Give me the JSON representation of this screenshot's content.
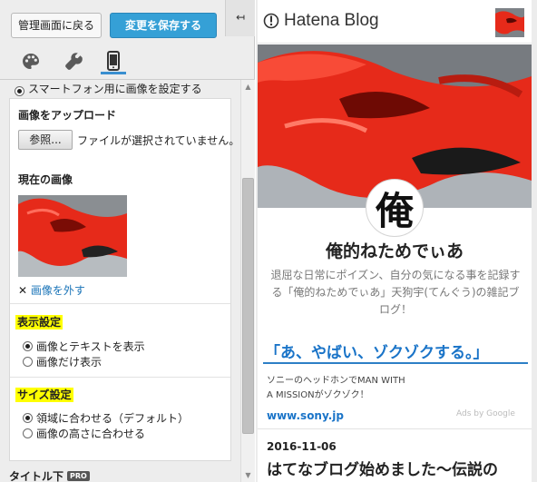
{
  "toolbar": {
    "back_label": "管理画面に戻る",
    "save_label": "変更を保存する",
    "collapse_glyph": "↤"
  },
  "tabs": [
    {
      "icon": "palette-icon",
      "label": "デザイン"
    },
    {
      "icon": "wrench-icon",
      "label": "カスタマイズ"
    },
    {
      "icon": "smartphone-icon",
      "label": "スマホ",
      "active": true
    }
  ],
  "panel": {
    "smartphone_image_option": "スマートフォン用に画像を設定する",
    "upload_heading": "画像をアップロード",
    "browse_label": "参照...",
    "file_status": "ファイルが選択されていません。",
    "current_image_heading": "現在の画像",
    "remove_image_label": "画像を外す",
    "display_heading": "表示設定",
    "display_options": [
      "画像とテキストを表示",
      "画像だけ表示"
    ],
    "display_selected": 0,
    "size_heading": "サイズ設定",
    "size_options": [
      "領域に合わせる（デフォルト）",
      "画像の高さに合わせる"
    ],
    "size_selected": 0,
    "next_section_label": "タイトル下",
    "pro_badge": "PRO"
  },
  "preview": {
    "logo_text": "Hatena Blog",
    "icon_char": "俺",
    "blog_title": "俺的ねためでぃあ",
    "blog_description": "退屈な日常にポイズン、自分の気になる事を記録する「俺的ねためでぃあ」天狗宇(てんぐう)の雑記ブログ！",
    "ad": {
      "headline": "「あ、やばい、ゾクゾクする。」",
      "body_line1": "ソニーのヘッドホンでMAN WITH",
      "body_line2": "A MISSIONがゾクゾク！",
      "domain": "www.sony.jp",
      "ads_by": "Ads by Google"
    },
    "post": {
      "date": "2016-11-06",
      "title": "はてなブログ始めました～伝説の"
    }
  },
  "colors": {
    "accent_blue": "#35a0d6",
    "link_blue": "#1a74c8",
    "highlight_yellow": "#ffff00",
    "cover_red": "#e62a1a"
  }
}
